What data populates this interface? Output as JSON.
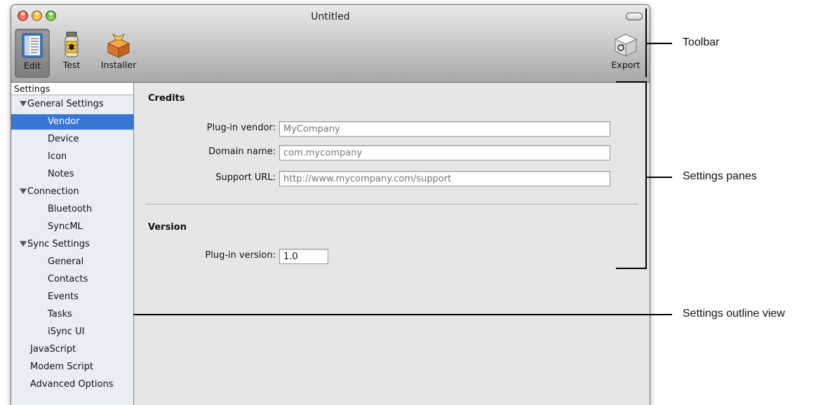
{
  "window": {
    "title": "Untitled"
  },
  "toolbar": {
    "items": [
      {
        "label": "Edit",
        "icon": "edit-icon",
        "selected": true
      },
      {
        "label": "Test",
        "icon": "bug-jar-icon"
      },
      {
        "label": "Installer",
        "icon": "package-icon"
      }
    ],
    "export_label": "Export",
    "export_icon": "export-cube-icon"
  },
  "sidebar": {
    "header": "Settings",
    "items": [
      {
        "label": "General Settings",
        "level": 0,
        "expanded": true
      },
      {
        "label": "Vendor",
        "level": 1,
        "selected": true
      },
      {
        "label": "Device",
        "level": 1
      },
      {
        "label": "Icon",
        "level": 1
      },
      {
        "label": "Notes",
        "level": 1
      },
      {
        "label": "Connection",
        "level": 0,
        "expanded": true
      },
      {
        "label": "Bluetooth",
        "level": 1
      },
      {
        "label": "SyncML",
        "level": 1
      },
      {
        "label": "Sync Settings",
        "level": 0,
        "expanded": true
      },
      {
        "label": "General",
        "level": 1
      },
      {
        "label": "Contacts",
        "level": 1
      },
      {
        "label": "Events",
        "level": 1
      },
      {
        "label": "Tasks",
        "level": 1
      },
      {
        "label": "iSync UI",
        "level": 1
      },
      {
        "label": "JavaScript",
        "level": 0
      },
      {
        "label": "Modem Script",
        "level": 0
      },
      {
        "label": "Advanced Options",
        "level": 0
      }
    ]
  },
  "credits": {
    "title": "Credits",
    "vendor_label": "Plug-in vendor:",
    "vendor_value": "MyCompany",
    "domain_label": "Domain name:",
    "domain_value": "com.mycompany",
    "support_label": "Support URL:",
    "support_value": "http://www.mycompany.com/support"
  },
  "version": {
    "title": "Version",
    "label": "Plug-in version:",
    "value": "1.0"
  },
  "callouts": {
    "toolbar": "Toolbar",
    "panes": "Settings panes",
    "outline": "Settings outline view"
  }
}
